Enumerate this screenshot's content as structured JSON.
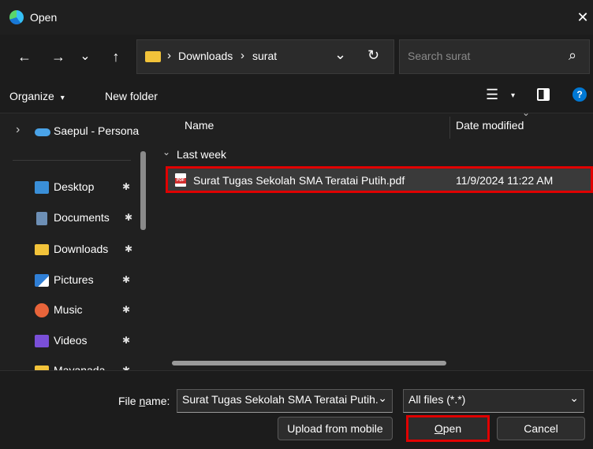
{
  "window": {
    "title": "Open",
    "close_glyph": "✕"
  },
  "nav": {
    "back_glyph": "←",
    "forward_glyph": "→",
    "recent_glyph": "⌄",
    "up_glyph": "↑",
    "breadcrumb": [
      "Downloads",
      "surat"
    ],
    "breadcrumb_sep": "›",
    "dropdown_glyph": "⌄",
    "refresh_glyph": "↻",
    "search_placeholder": "Search surat",
    "search_glyph": "⌕"
  },
  "command_bar": {
    "organize_label": "Organize",
    "organize_arrow": "▾",
    "new_folder_label": "New folder",
    "view_glyph": "☰",
    "view_arrow": "▾",
    "help_glyph": "?"
  },
  "sidebar": {
    "onedrive": {
      "label": "Saepul - Persona",
      "expand_glyph": "›"
    },
    "items": [
      {
        "label": "Desktop",
        "icon": "desktop-icon",
        "color": "#3a8fd8"
      },
      {
        "label": "Documents",
        "icon": "documents-icon",
        "color": "#6d8fb5"
      },
      {
        "label": "Downloads",
        "icon": "folder-icon",
        "color": "#f2c33a"
      },
      {
        "label": "Pictures",
        "icon": "pictures-icon",
        "color": "#2f7fd6"
      },
      {
        "label": "Music",
        "icon": "music-icon",
        "color": "#e8643a"
      },
      {
        "label": "Videos",
        "icon": "videos-icon",
        "color": "#7a4fd8"
      },
      {
        "label": "Mayanada",
        "icon": "folder-icon",
        "color": "#f2c33a"
      }
    ],
    "pin_glyph": "📌"
  },
  "file_list": {
    "columns": [
      "Name",
      "Date modified"
    ],
    "sort_glyph": "⌄",
    "group_label": "Last week",
    "group_glyph": "⌄",
    "files": [
      {
        "name": "Surat Tugas Sekolah SMA Teratai Putih.pdf",
        "date": "11/9/2024 11:22 AM",
        "icon_text": "PDF"
      }
    ]
  },
  "footer": {
    "file_name_label_pre": "File ",
    "file_name_label_u": "n",
    "file_name_label_post": "ame:",
    "file_name_value": "Surat Tugas Sekolah SMA Teratai Putih.",
    "file_type_value": "All files (*.*)",
    "dropdown_glyph": "⌄",
    "upload_label": "Upload from mobile",
    "open_label_u": "O",
    "open_label_rest": "pen",
    "cancel_label": "Cancel"
  },
  "colors": {
    "highlight": "#e00000",
    "accent": "#0078d4"
  }
}
